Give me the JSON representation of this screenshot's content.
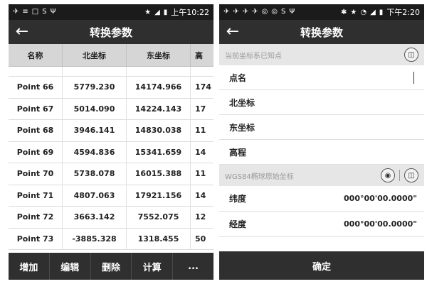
{
  "left": {
    "status": {
      "icons": [
        "✈",
        "≡",
        "□",
        "S",
        "Ψ"
      ],
      "right_glyphs": [
        "★",
        "◢",
        "▮"
      ],
      "time": "上午10:22"
    },
    "title": "转换参数",
    "table": {
      "headers": {
        "name": "名称",
        "north": "北坐标",
        "east": "东坐标",
        "h": "高"
      },
      "rows": [
        {
          "name": "Point 66",
          "north": "5779.230",
          "east": "14174.966",
          "h": "174"
        },
        {
          "name": "Point 67",
          "north": "5014.090",
          "east": "14224.143",
          "h": "17"
        },
        {
          "name": "Point 68",
          "north": "3946.141",
          "east": "14830.038",
          "h": "11"
        },
        {
          "name": "Point 69",
          "north": "4594.836",
          "east": "15341.659",
          "h": "14"
        },
        {
          "name": "Point 70",
          "north": "5738.078",
          "east": "16015.388",
          "h": "11"
        },
        {
          "name": "Point 71",
          "north": "4807.063",
          "east": "17921.156",
          "h": "14"
        },
        {
          "name": "Point 72",
          "north": "3663.142",
          "east": "7552.075",
          "h": "12"
        },
        {
          "name": "Point 73",
          "north": "-3885.328",
          "east": "1318.455",
          "h": "50"
        }
      ]
    },
    "bottom": {
      "add": "增加",
      "edit": "编辑",
      "delete": "删除",
      "calc": "计算",
      "more": "..."
    }
  },
  "right": {
    "status": {
      "icons": [
        "✈",
        "✈",
        "✈",
        "✈",
        "◎",
        "◎",
        "S",
        "Ψ"
      ],
      "right_glyphs": [
        "✱",
        "★",
        "◔",
        "◢",
        "▮"
      ],
      "time": "下午2:20"
    },
    "title": "转换参数",
    "known_section": {
      "label": "当前坐标系已知点"
    },
    "fields": {
      "point_name": "点名",
      "north": "北坐标",
      "east": "东坐标",
      "elevation": "高程"
    },
    "wgs_section": {
      "label": "WGS84椭球原始坐标"
    },
    "latitude": {
      "label": "纬度",
      "value": "000°00'00.0000\""
    },
    "longitude": {
      "label": "经度",
      "value": "000°00'00.0000\""
    },
    "confirm": "确定"
  }
}
